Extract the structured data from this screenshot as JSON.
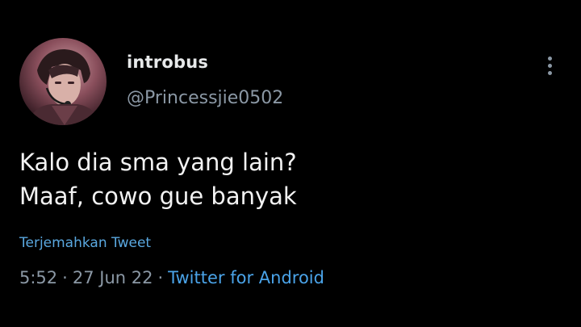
{
  "tweet": {
    "display_name": "introbus",
    "handle": "@Princessjie0502",
    "text_lines": [
      "Kalo dia sma yang lain?",
      "Maaf, cowo gue banyak"
    ],
    "translate_label": "Terjemahkan Tweet",
    "time": "5:52",
    "separator": "·",
    "date": "27 Jun 22",
    "source": "Twitter for Android"
  },
  "icons": {
    "more": "more-vertical-icon",
    "avatar": "avatar"
  },
  "colors": {
    "background": "#000000",
    "primary_text": "#e7e9ea",
    "secondary_text": "#8b98a5",
    "link": "#4aa3e8"
  }
}
